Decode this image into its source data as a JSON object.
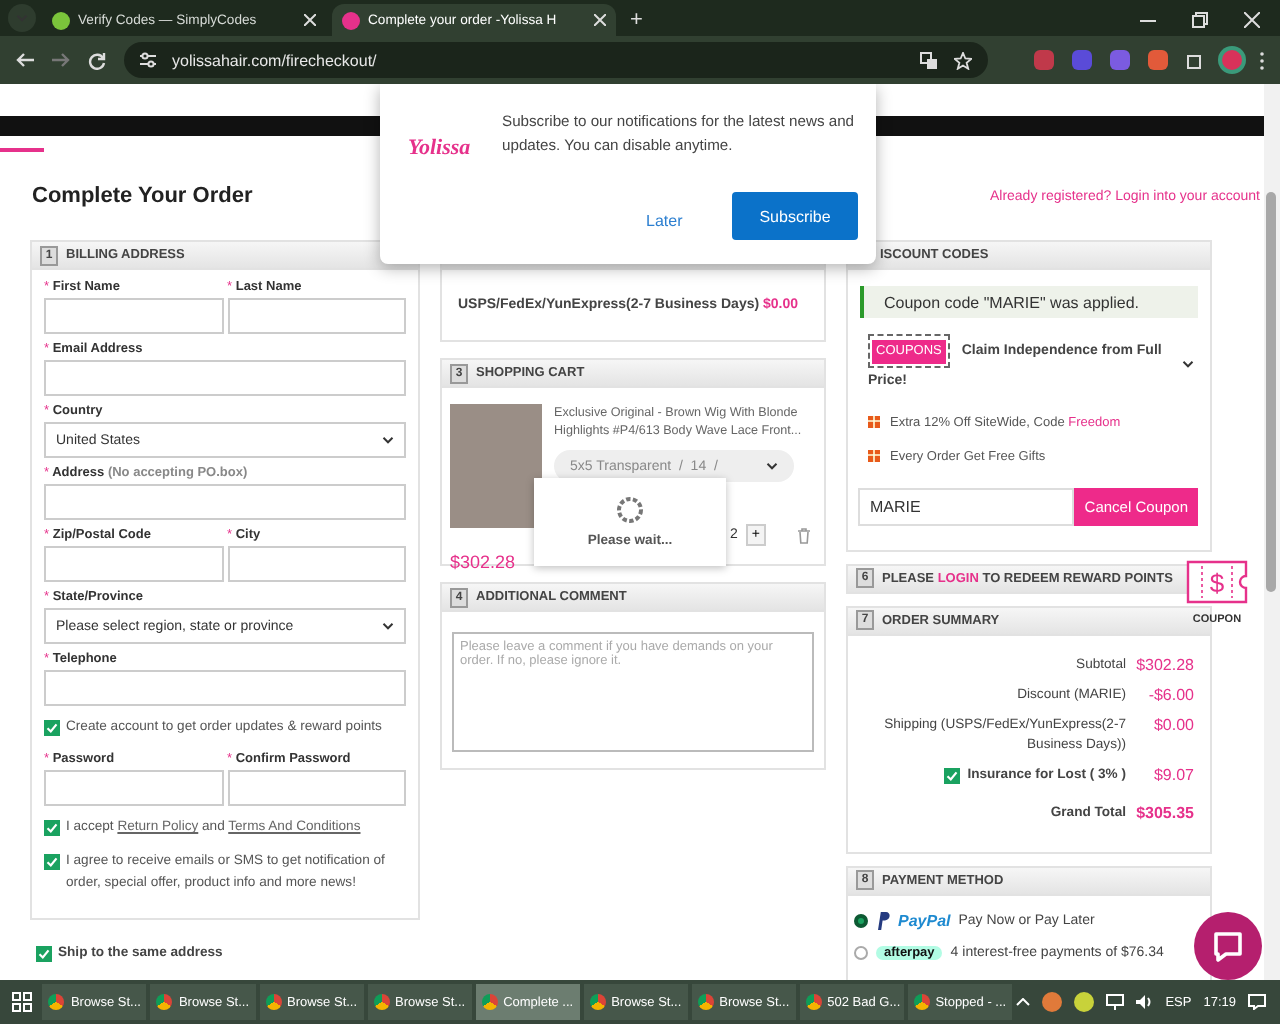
{
  "browser": {
    "tabs": [
      {
        "title": "Verify Codes — SimplyCodes",
        "selected": false
      },
      {
        "title": "Complete your order -Yolissa H",
        "selected": true
      }
    ],
    "new_tab": "+",
    "url": "yolissahair.com/firecheckout/"
  },
  "popup": {
    "logo": "Yolissa",
    "message": "Subscribe to our notifications for the latest news and updates. You can disable anytime.",
    "buttons": [
      {
        "label": "Later",
        "kind": "text"
      },
      {
        "label": "Subscribe",
        "kind": "primary"
      }
    ]
  },
  "page_title": "Complete Your Order",
  "login_prompt": "Already registered? Login into your account",
  "billing": {
    "number": "1",
    "title": "BILLING ADDRESS",
    "items": [
      {
        "kind": "fields",
        "fields": [
          {
            "mark": "*",
            "label": "First Name",
            "kind": "text"
          },
          {
            "mark": "*",
            "label": "Last Name",
            "kind": "text"
          }
        ]
      },
      {
        "kind": "fields",
        "fields": [
          {
            "mark": "*",
            "label": "Email Address",
            "kind": "text"
          }
        ]
      },
      {
        "kind": "fields",
        "fields": [
          {
            "mark": "*",
            "label": "Country",
            "kind": "select",
            "value": "United States"
          }
        ]
      },
      {
        "kind": "fields",
        "fields": [
          {
            "mark": "*",
            "label": "Address",
            "note": "(No accepting PO.box)",
            "kind": "text"
          }
        ]
      },
      {
        "kind": "fields",
        "fields": [
          {
            "mark": "*",
            "label": "Zip/Postal Code",
            "kind": "text"
          },
          {
            "mark": "*",
            "label": "City",
            "kind": "text"
          }
        ]
      },
      {
        "kind": "fields",
        "fields": [
          {
            "mark": "*",
            "label": "State/Province",
            "kind": "select",
            "value": "Please select region, state or province"
          }
        ]
      },
      {
        "kind": "fields",
        "fields": [
          {
            "mark": "*",
            "label": "Telephone",
            "kind": "text"
          }
        ]
      },
      {
        "kind": "checkbox",
        "checked": true,
        "parts": [
          {
            "text": "Create account to get order updates & reward points"
          }
        ]
      },
      {
        "kind": "fields",
        "fields": [
          {
            "mark": "*",
            "label": "Password",
            "kind": "text"
          },
          {
            "mark": "*",
            "label": "Confirm Password",
            "kind": "text"
          }
        ]
      },
      {
        "kind": "checkbox",
        "checked": true,
        "parts": [
          {
            "text": "I accept "
          },
          {
            "text": "Return Policy",
            "link": true
          },
          {
            "text": " and "
          },
          {
            "text": "Terms And Conditions",
            "link": true
          }
        ]
      },
      {
        "kind": "checkbox",
        "checked": true,
        "parts": [
          {
            "text": "I agree to receive emails or SMS to get notification of order, special offer, product info and more news!"
          }
        ]
      }
    ]
  },
  "ship_same": {
    "label": "Ship to the same address",
    "checked": true
  },
  "shipping": {
    "text": "USPS/FedEx/YunExpress(2-7 Business Days)",
    "price": "$0.00"
  },
  "cart": {
    "number": "3",
    "title": "SHOPPING CART",
    "product": "Exclusive Original - Brown Wig With Blonde Highlights #P4/613 Body Wave Lace Front...",
    "option": "5x5 Transparent  /  14  /",
    "price": "$302.28",
    "qty": "2",
    "plus": "+",
    "loading": "Please wait..."
  },
  "comment": {
    "number": "4",
    "title": "ADDITIONAL COMMENT",
    "placeholder": "Please leave a comment if you have demands on your order. If no, please ignore it."
  },
  "discount": {
    "title": "ISCOUNT CODES",
    "applied": "Coupon code \"MARIE\" was applied.",
    "tag": "COUPONS",
    "promo": "Claim Independence from Full Price!",
    "perks": [
      {
        "parts": [
          {
            "text": "Extra 12% Off SiteWide, Code "
          },
          {
            "text": "Freedom",
            "highlight": true
          }
        ]
      },
      {
        "parts": [
          {
            "text": "Every Order Get Free Gifts"
          }
        ]
      }
    ],
    "code": "MARIE",
    "button": "Cancel Coupon"
  },
  "rewards": {
    "number": "6",
    "parts": [
      {
        "text": "PLEASE "
      },
      {
        "text": "LOGIN",
        "link": true
      },
      {
        "text": " TO REDEEM REWARD POINTS"
      }
    ]
  },
  "coupon_badge": {
    "symbol": "$",
    "label": "COUPON"
  },
  "summary": {
    "number": "7",
    "title": "ORDER SUMMARY",
    "rows": [
      {
        "kind": "line",
        "label": "Subtotal",
        "value": "$302.28"
      },
      {
        "kind": "line",
        "label": "Discount (MARIE)",
        "value": "-$6.00"
      },
      {
        "kind": "line",
        "label": "Shipping (USPS/FedEx/YunExpress(2-7 Business Days))",
        "value": "$0.00"
      },
      {
        "kind": "option",
        "label": "Insurance for Lost ( 3% )",
        "value": "$9.07",
        "checked": true
      },
      {
        "kind": "total",
        "label": "Grand Total",
        "value": "$305.35"
      }
    ]
  },
  "payment": {
    "number": "8",
    "title": "PAYMENT METHOD",
    "options": [
      {
        "kind": "paypal",
        "logo": "PayPal",
        "text": "Pay Now or Pay Later",
        "selected": true
      },
      {
        "kind": "afterpay",
        "logo": "afterpay",
        "text": "4 interest-free payments of $76.34",
        "selected": false
      }
    ]
  },
  "taskbar": {
    "items": [
      {
        "label": "Browse St...",
        "selected": false
      },
      {
        "label": "Browse St...",
        "selected": false
      },
      {
        "label": "Browse St...",
        "selected": false
      },
      {
        "label": "Browse St...",
        "selected": false
      },
      {
        "label": "Complete ...",
        "selected": true
      },
      {
        "label": "Browse St...",
        "selected": false
      },
      {
        "label": "Browse St...",
        "selected": false
      },
      {
        "label": "502 Bad G...",
        "selected": false
      },
      {
        "label": "Stopped - ...",
        "selected": false
      }
    ],
    "language": "ESP",
    "time": "17:19"
  }
}
